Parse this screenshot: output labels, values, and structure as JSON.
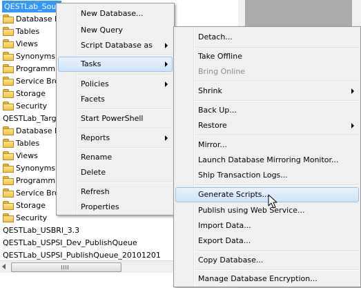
{
  "tree": {
    "nodes": [
      {
        "label": "QESTLab_Sour",
        "type": "database",
        "selected": true
      },
      {
        "label": "Database D",
        "type": "folder"
      },
      {
        "label": "Tables",
        "type": "folder"
      },
      {
        "label": "Views",
        "type": "folder"
      },
      {
        "label": "Synonyms",
        "type": "folder"
      },
      {
        "label": "Programm",
        "type": "folder"
      },
      {
        "label": "Service Bro",
        "type": "folder"
      },
      {
        "label": "Storage",
        "type": "folder"
      },
      {
        "label": "Security",
        "type": "folder"
      },
      {
        "label": "QESTLab_Targ",
        "type": "database"
      },
      {
        "label": "Database D",
        "type": "folder"
      },
      {
        "label": "Tables",
        "type": "folder"
      },
      {
        "label": "Views",
        "type": "folder"
      },
      {
        "label": "Synonyms",
        "type": "folder"
      },
      {
        "label": "Programm",
        "type": "folder"
      },
      {
        "label": "Service Bro",
        "type": "folder"
      },
      {
        "label": "Storage",
        "type": "folder"
      },
      {
        "label": "Security",
        "type": "folder"
      },
      {
        "label": "QESTLab_USBRI_3.3",
        "type": "database"
      },
      {
        "label": "QESTLab_USPSI_Dev_PublishQueue",
        "type": "database"
      },
      {
        "label": "QESTLab_USPSI_PublishQueue_20101201",
        "type": "database"
      }
    ]
  },
  "context_menu": {
    "items": [
      {
        "label": "New Database...",
        "submenu": false
      },
      {
        "label": "New Query",
        "submenu": false
      },
      {
        "label": "Script Database as",
        "submenu": true
      },
      {
        "separator": true
      },
      {
        "label": "Tasks",
        "submenu": true,
        "highlighted": true
      },
      {
        "separator": true
      },
      {
        "label": "Policies",
        "submenu": true
      },
      {
        "label": "Facets",
        "submenu": false
      },
      {
        "separator": true
      },
      {
        "label": "Start PowerShell",
        "submenu": false
      },
      {
        "separator": true
      },
      {
        "label": "Reports",
        "submenu": true
      },
      {
        "separator": true
      },
      {
        "label": "Rename",
        "submenu": false
      },
      {
        "label": "Delete",
        "submenu": false
      },
      {
        "separator": true
      },
      {
        "label": "Refresh",
        "submenu": false
      },
      {
        "label": "Properties",
        "submenu": false
      }
    ]
  },
  "tasks_menu": {
    "items": [
      {
        "label": "Detach...",
        "submenu": false
      },
      {
        "separator": true
      },
      {
        "label": "Take Offline",
        "submenu": false
      },
      {
        "label": "Bring Online",
        "submenu": false,
        "disabled": true
      },
      {
        "separator": true
      },
      {
        "label": "Shrink",
        "submenu": true
      },
      {
        "separator": true
      },
      {
        "label": "Back Up...",
        "submenu": false
      },
      {
        "label": "Restore",
        "submenu": true
      },
      {
        "separator": true
      },
      {
        "label": "Mirror...",
        "submenu": false
      },
      {
        "label": "Launch Database Mirroring Monitor...",
        "submenu": false
      },
      {
        "label": "Ship Transaction Logs...",
        "submenu": false
      },
      {
        "separator": true
      },
      {
        "label": "Generate Scripts...",
        "submenu": false,
        "highlighted": true
      },
      {
        "label": "Publish using Web Service...",
        "submenu": false
      },
      {
        "label": "Import Data...",
        "submenu": false
      },
      {
        "label": "Export Data...",
        "submenu": false
      },
      {
        "separator": true
      },
      {
        "label": "Copy Database...",
        "submenu": false
      },
      {
        "separator": true
      },
      {
        "label": "Manage Database Encryption...",
        "submenu": false
      }
    ]
  },
  "colors": {
    "selection": "#3399ff",
    "menu_background": "#f0f0f0",
    "menu_highlight_border": "#95c0ea",
    "disabled_text": "#8d8d8d"
  },
  "icons": {
    "tree_folder": "folder-icon",
    "submenu": "chevron-right-icon",
    "pointer": "mouse-cursor-icon",
    "scroll_left": "arrow-left-icon",
    "scroll_grip": "grip-icon"
  }
}
